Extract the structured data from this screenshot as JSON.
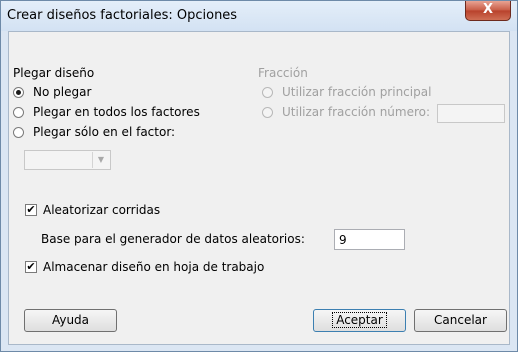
{
  "window": {
    "title": "Crear diseños factoriales: Opciones",
    "close_glyph": "X"
  },
  "fold": {
    "heading": "Plegar diseño",
    "options": [
      {
        "label": "No plegar",
        "checked": true
      },
      {
        "label": "Plegar en todos los factores",
        "checked": false
      },
      {
        "label": "Plegar sólo en el factor:",
        "checked": false
      }
    ],
    "factor_select": {
      "value": ""
    }
  },
  "fraction": {
    "heading": "Fracción",
    "principal_label": "Utilizar fracción principal",
    "number_label": "Utilizar fracción número:",
    "number_value": ""
  },
  "randomize": {
    "label": "Aleatorizar corridas",
    "checked": true
  },
  "seed": {
    "label": "Base para el generador de datos aleatorios:",
    "value": "9"
  },
  "store": {
    "label": "Almacenar diseño en hoja de trabajo",
    "checked": true
  },
  "buttons": {
    "help": "Ayuda",
    "ok": "Aceptar",
    "cancel": "Cancelar"
  },
  "check_glyph": "✔"
}
